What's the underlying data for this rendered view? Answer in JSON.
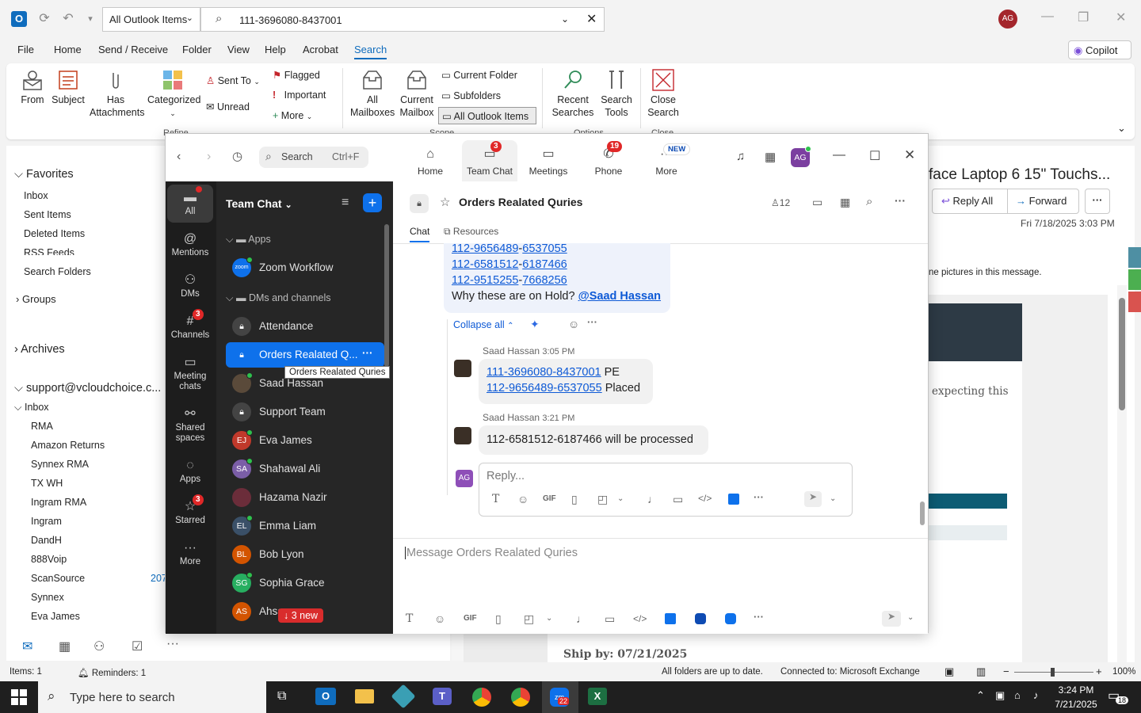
{
  "outlook": {
    "scope": "All Outlook Items",
    "search_query": "111-3696080-8437001",
    "user_initials": "AG",
    "menu": [
      "File",
      "Home",
      "Send / Receive",
      "Folder",
      "View",
      "Help",
      "Acrobat",
      "Search"
    ],
    "copilot": "Copilot",
    "ribbon": {
      "from": "From",
      "subject": "Subject",
      "has_attachments": "Has Attachments",
      "categorized": "Categorized",
      "sent_to": "Sent To",
      "unread": "Unread",
      "flagged": "Flagged",
      "important": "Important",
      "more": "More",
      "all_mailboxes": "All Mailboxes",
      "current_mailbox": "Current Mailbox",
      "current_folder": "Current Folder",
      "subfolders": "Subfolders",
      "all_outlook_items": "All Outlook Items",
      "recent_searches": "Recent Searches",
      "search_tools": "Search Tools",
      "close_search": "Close Search",
      "group_refine": "Refine",
      "group_scope": "Scope",
      "group_options": "Options",
      "group_close": "Close"
    },
    "nav": {
      "favorites": "Favorites",
      "inbox": "Inbox",
      "sent_items": "Sent Items",
      "deleted_items": "Deleted Items",
      "rss_feeds": "RSS Feeds",
      "search_folders": "Search Folders",
      "groups": "Groups",
      "archives": "Archives",
      "account": "support@vcloudchoice.c...",
      "account_inbox": "Inbox",
      "folders": [
        "RMA",
        "Amazon Returns",
        "Synnex RMA",
        "TX WH",
        "Ingram RMA",
        "Ingram",
        "DandH",
        "888Voip",
        "ScanSource",
        "Synnex",
        "Eva James"
      ],
      "scansource_count": "207"
    },
    "reading": {
      "subject": "face Laptop 6 15\" Touchs...",
      "reply_all": "Reply All",
      "forward": "Forward",
      "date": "Fri 7/18/2025 3:03 PM",
      "pictures_notice": "ne pictures in this message.",
      "expecting": "expecting this",
      "ship_by": "Ship by: 07/21/2025"
    },
    "status": {
      "items": "Items: 1",
      "reminders": "Reminders: 1",
      "folders_status": "All folders are up to date.",
      "connected": "Connected to: Microsoft Exchange",
      "zoom": "100%"
    }
  },
  "zoom": {
    "search_placeholder": "Search",
    "search_shortcut": "Ctrl+F",
    "tabs": [
      {
        "label": "Home",
        "badge": ""
      },
      {
        "label": "Team Chat",
        "badge": "3"
      },
      {
        "label": "Meetings",
        "badge": ""
      },
      {
        "label": "Phone",
        "badge": "19"
      },
      {
        "label": "More",
        "badge": "NEW"
      }
    ],
    "user_initials": "AG",
    "rail": [
      {
        "label": "All",
        "badge": ""
      },
      {
        "label": "Mentions",
        "badge": ""
      },
      {
        "label": "DMs",
        "badge": ""
      },
      {
        "label": "Channels",
        "badge": "3"
      },
      {
        "label": "Meeting chats",
        "badge": ""
      },
      {
        "label": "Shared spaces",
        "badge": ""
      },
      {
        "label": "Apps",
        "badge": ""
      },
      {
        "label": "Starred",
        "badge": "3"
      },
      {
        "label": "More",
        "badge": ""
      }
    ],
    "list_title": "Team Chat",
    "section_apps": "Apps",
    "section_dms": "DMs and channels",
    "items": [
      {
        "name": "Zoom Workflow",
        "initials": "zoom",
        "color": "#0e71eb"
      },
      {
        "name": "Attendance",
        "initials": "",
        "color": "#444444"
      },
      {
        "name": "Orders Realated Q...",
        "initials": "",
        "color": "#0e71eb"
      },
      {
        "name": "Saad Hassan",
        "initials": "",
        "color": "#5a4a3a"
      },
      {
        "name": "Support Team",
        "initials": "",
        "color": "#444444"
      },
      {
        "name": "Eva James",
        "initials": "EJ",
        "color": "#c0392b"
      },
      {
        "name": "Shahawal Ali",
        "initials": "SA",
        "color": "#7b5ea7"
      },
      {
        "name": "Hazama Nazir",
        "initials": "",
        "color": "#6b2d3a"
      },
      {
        "name": "Emma Liam",
        "initials": "EL",
        "color": "#3a5068"
      },
      {
        "name": "Bob Lyon",
        "initials": "BL",
        "color": "#d35400"
      },
      {
        "name": "Sophia Grace",
        "initials": "SG",
        "color": "#27ae60"
      },
      {
        "name": "Ahsa",
        "initials": "AS",
        "color": "#d35400"
      }
    ],
    "new_pill": "↓ 3 new",
    "tooltip": "Orders Realated Quries",
    "channel": {
      "name": "Orders Realated Quries",
      "members": "12",
      "tab_chat": "Chat",
      "tab_resources": "Resources"
    },
    "thread_top": {
      "lines": [
        [
          "112-9656489",
          "6537055"
        ],
        [
          "112-6581512",
          "6187466"
        ],
        [
          "112-9515255",
          "7668256"
        ]
      ],
      "question": "Why these are on Hold?",
      "mention": "@Saad Hassan"
    },
    "collapse": "Collapse all",
    "replies": [
      {
        "author": "Saad Hassan",
        "time": "3:05 PM",
        "line1_link": "111-3696080-8437001",
        "line1_suffix": " PE",
        "line2_link": "112-9656489-6537055",
        "line2_suffix": " Placed"
      },
      {
        "author": "Saad Hassan",
        "time": "3:21 PM",
        "text": "112-6581512-6187466 will be processed"
      }
    ],
    "reply_placeholder": "Reply...",
    "reply_avatar": "AG",
    "compose_placeholder": "Message Orders Realated Quries"
  },
  "taskbar": {
    "search": "Type here to search",
    "time": "3:24 PM",
    "date": "7/21/2025",
    "zoom_badge": "22",
    "notif": "18"
  }
}
